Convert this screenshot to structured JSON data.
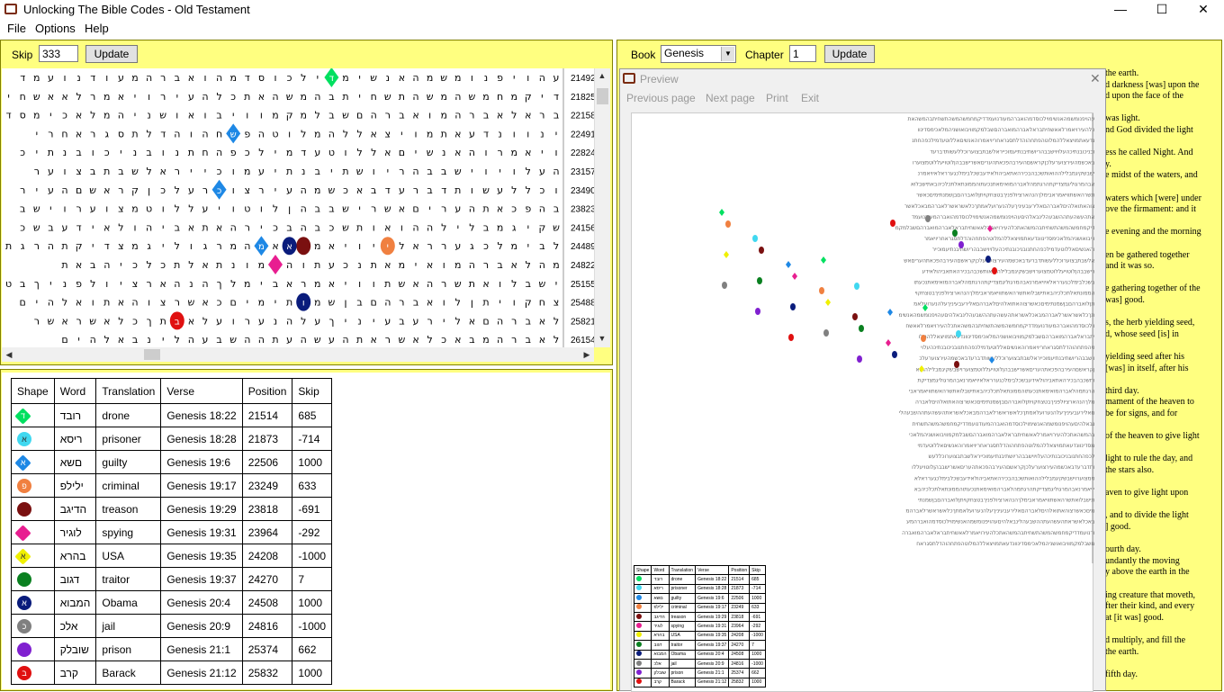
{
  "window": {
    "title": "Unlocking The Bible Codes - Old Testament",
    "minimize": "—",
    "maximize": "☐",
    "close": "✕"
  },
  "menu": [
    "File",
    "Options",
    "Help"
  ],
  "skip_bar": {
    "label": "Skip",
    "value": "333",
    "update_label": "Update"
  },
  "book_bar": {
    "book_label": "Book",
    "book_value": "Genesis",
    "chapter_label": "Chapter",
    "chapter_value": "1",
    "update_label": "Update"
  },
  "grid": {
    "rows": [
      {
        "text": "עהויפנומשמהאנשימוילכוסדמהואברהמעודנועמד",
        "pos": "21492"
      },
      {
        "text": "דיקמחמשהמשהתשחיתבהמשהאתכלהעירויאמרלאאשחית",
        "pos": "21825"
      },
      {
        "text": "בראלאברהמואברהםשבלמקמוויבואושניהמלאכימסד",
        "pos": "22158"
      },
      {
        "text": "ינוונדעאתמויצאללהמלוטהפתחהוהדלתסגראחרי",
        "pos": "22491"
      },
      {
        "text": "ויאמרוהאנשיםאללוטעדמילכפהחתנובניכובנתיכ",
        "pos": "22824"
      },
      {
        "text": "העלויוישבבהריושתיבנתיעמוכייראלשבתבצוער",
        "pos": "23157"
      },
      {
        "text": "וכללעשותדברעדבאכשמהעירצוערעלכןקראשםהעיר",
        "pos": "23490"
      },
      {
        "text": "בהפכאתהעריםאשרישבבהןלוטויעללוטמצוערוישב",
        "pos": "23823"
      },
      {
        "text": "שקיגמבלילההואותשכבהבכירהאתאביהולאידעבשכ",
        "pos": "24156"
      },
      {
        "text": "לבימלכגערראלאיויאמרנאבהמרגוליגמצדיקתהרגת",
        "pos": "24489"
      },
      {
        "text": "מהלאברהמואימאתנכעתוהממונתאלתכלכיהבאת",
        "pos": "24822"
      },
      {
        "text": "ישבלואתשרהאשתוויאמראבימלךהנהארציולפניךבט",
        "pos": "25155"
      },
      {
        "text": "צחקויתןלואברהםבןשמנתימיםכאשרצוהאתואלהים",
        "pos": "25488"
      },
      {
        "text": "לאברהםאלירעבעיניךעלהנערועלאמתךכלאשראשר",
        "pos": "25821"
      },
      {
        "text": "לאברהמבאכלאשראתהעשהעתההשבעהלינבאלהים",
        "pos": "26154"
      }
    ],
    "markers": [
      {
        "row": 0,
        "col": 16,
        "letter": "ד",
        "color": "#00e060",
        "shape": "diamond"
      },
      {
        "row": 3,
        "col": 23,
        "letter": "ש",
        "color": "#1e88e5",
        "shape": "diamond"
      },
      {
        "row": 6,
        "col": 24,
        "letter": "כ",
        "color": "#1e88e5",
        "shape": "diamond"
      },
      {
        "row": 9,
        "col": 12,
        "letter": "י",
        "color": "#f08040",
        "shape": "circle"
      },
      {
        "row": 9,
        "col": 18,
        "letter": "",
        "color": "#7a1010",
        "shape": "circle"
      },
      {
        "row": 9,
        "col": 19,
        "letter": "א",
        "color": "#0a1c7c",
        "shape": "circle"
      },
      {
        "row": 9,
        "col": 21,
        "letter": "מ",
        "color": "#1e88e5",
        "shape": "diamond"
      },
      {
        "row": 10,
        "col": 20,
        "letter": "",
        "color": "#e81e90",
        "shape": "diamond"
      },
      {
        "row": 12,
        "col": 18,
        "letter": "ו",
        "color": "#0a1c7c",
        "shape": "circle"
      },
      {
        "row": 13,
        "col": 27,
        "letter": "ב",
        "color": "#e01010",
        "shape": "circle"
      }
    ]
  },
  "results": {
    "headers": [
      "Shape",
      "Word",
      "Translation",
      "Verse",
      "Position",
      "Skip"
    ],
    "rows": [
      {
        "letter": "ד",
        "color": "#00e060",
        "shape": "diamond",
        "word": "רובד",
        "translation": "drone",
        "verse": "Genesis 18:22",
        "position": "21514",
        "skip": "685"
      },
      {
        "letter": "א",
        "color": "#40d8f0",
        "shape": "circle",
        "word": "ריסא",
        "translation": "prisoner",
        "verse": "Genesis 18:28",
        "position": "21873",
        "skip": "-714"
      },
      {
        "letter": "א",
        "color": "#1e88e5",
        "shape": "diamond",
        "word": "םשא",
        "translation": "guilty",
        "verse": "Genesis 19:6",
        "position": "22506",
        "skip": "1000"
      },
      {
        "letter": "פ",
        "color": "#f08040",
        "shape": "circle",
        "word": "ילילפ",
        "translation": "criminal",
        "verse": "Genesis 19:17",
        "position": "23249",
        "skip": "633"
      },
      {
        "letter": "",
        "color": "#7a1010",
        "shape": "circle",
        "word": "הדיגב",
        "translation": "treason",
        "verse": "Genesis 19:29",
        "position": "23818",
        "skip": "-691"
      },
      {
        "letter": "",
        "color": "#e81e90",
        "shape": "diamond",
        "word": "לוגיר",
        "translation": "spying",
        "verse": "Genesis 19:31",
        "position": "23964",
        "skip": "-292"
      },
      {
        "letter": "א",
        "color": "#f0f000",
        "shape": "diamond",
        "word": "בהרא",
        "translation": "USA",
        "verse": "Genesis 19:35",
        "position": "24208",
        "skip": "-1000"
      },
      {
        "letter": "",
        "color": "#0a8020",
        "shape": "circle",
        "word": "דגוב",
        "translation": "traitor",
        "verse": "Genesis 19:37",
        "position": "24270",
        "skip": "7"
      },
      {
        "letter": "א",
        "color": "#0a1c7c",
        "shape": "circle",
        "word": "המבוא",
        "translation": "Obama",
        "verse": "Genesis 20:4",
        "position": "24508",
        "skip": "1000"
      },
      {
        "letter": "כ",
        "color": "#808080",
        "shape": "circle",
        "word": "אלכ",
        "translation": "jail",
        "verse": "Genesis 20:9",
        "position": "24816",
        "skip": "-1000"
      },
      {
        "letter": "",
        "color": "#8020d0",
        "shape": "circle",
        "word": "שובלק",
        "translation": "prison",
        "verse": "Genesis 21:1",
        "position": "25374",
        "skip": "662"
      },
      {
        "letter": "ב",
        "color": "#e01010",
        "shape": "circle",
        "word": "קרב",
        "translation": "Barack",
        "verse": "Genesis 21:12",
        "position": "25832",
        "skip": "1000"
      }
    ]
  },
  "preview": {
    "title": "Preview",
    "menu": [
      "Previous page",
      "Next page",
      "Print",
      "Exit"
    ],
    "close": "✕"
  },
  "verse_text": [
    "the earth.",
    "d darkness [was] upon the",
    "d upon the face of the",
    "",
    "was light.",
    "nd God divided the light",
    "",
    "ess he called Night. And",
    "y.",
    "e midst of the waters, and",
    "",
    "waters which [were] under",
    "ove the firmament: and it",
    "",
    "e evening and the morning",
    "",
    "en be gathered together",
    "and it was so.",
    "",
    "e gathering together of the",
    "was] good.",
    "",
    "s, the herb yielding seed,",
    "d, whose seed [is] in",
    "",
    "yielding seed after his",
    "[was] in itself, after his",
    "",
    "third day.",
    "mament of the heaven to",
    "be for signs, and for",
    "",
    "of the heaven to give light",
    "",
    "light to rule the day, and",
    "the stars also.",
    "",
    "aven to give light upon",
    "",
    ", and to divide the light",
    "] good.",
    "",
    "ourth day.",
    "undantly the moving",
    "y above the earth in the",
    "",
    "ing creature that moveth,",
    "fter their kind, and every",
    "at [it was] good.",
    "",
    "d multiply, and fill the",
    "the earth.",
    "",
    "fifth day."
  ]
}
